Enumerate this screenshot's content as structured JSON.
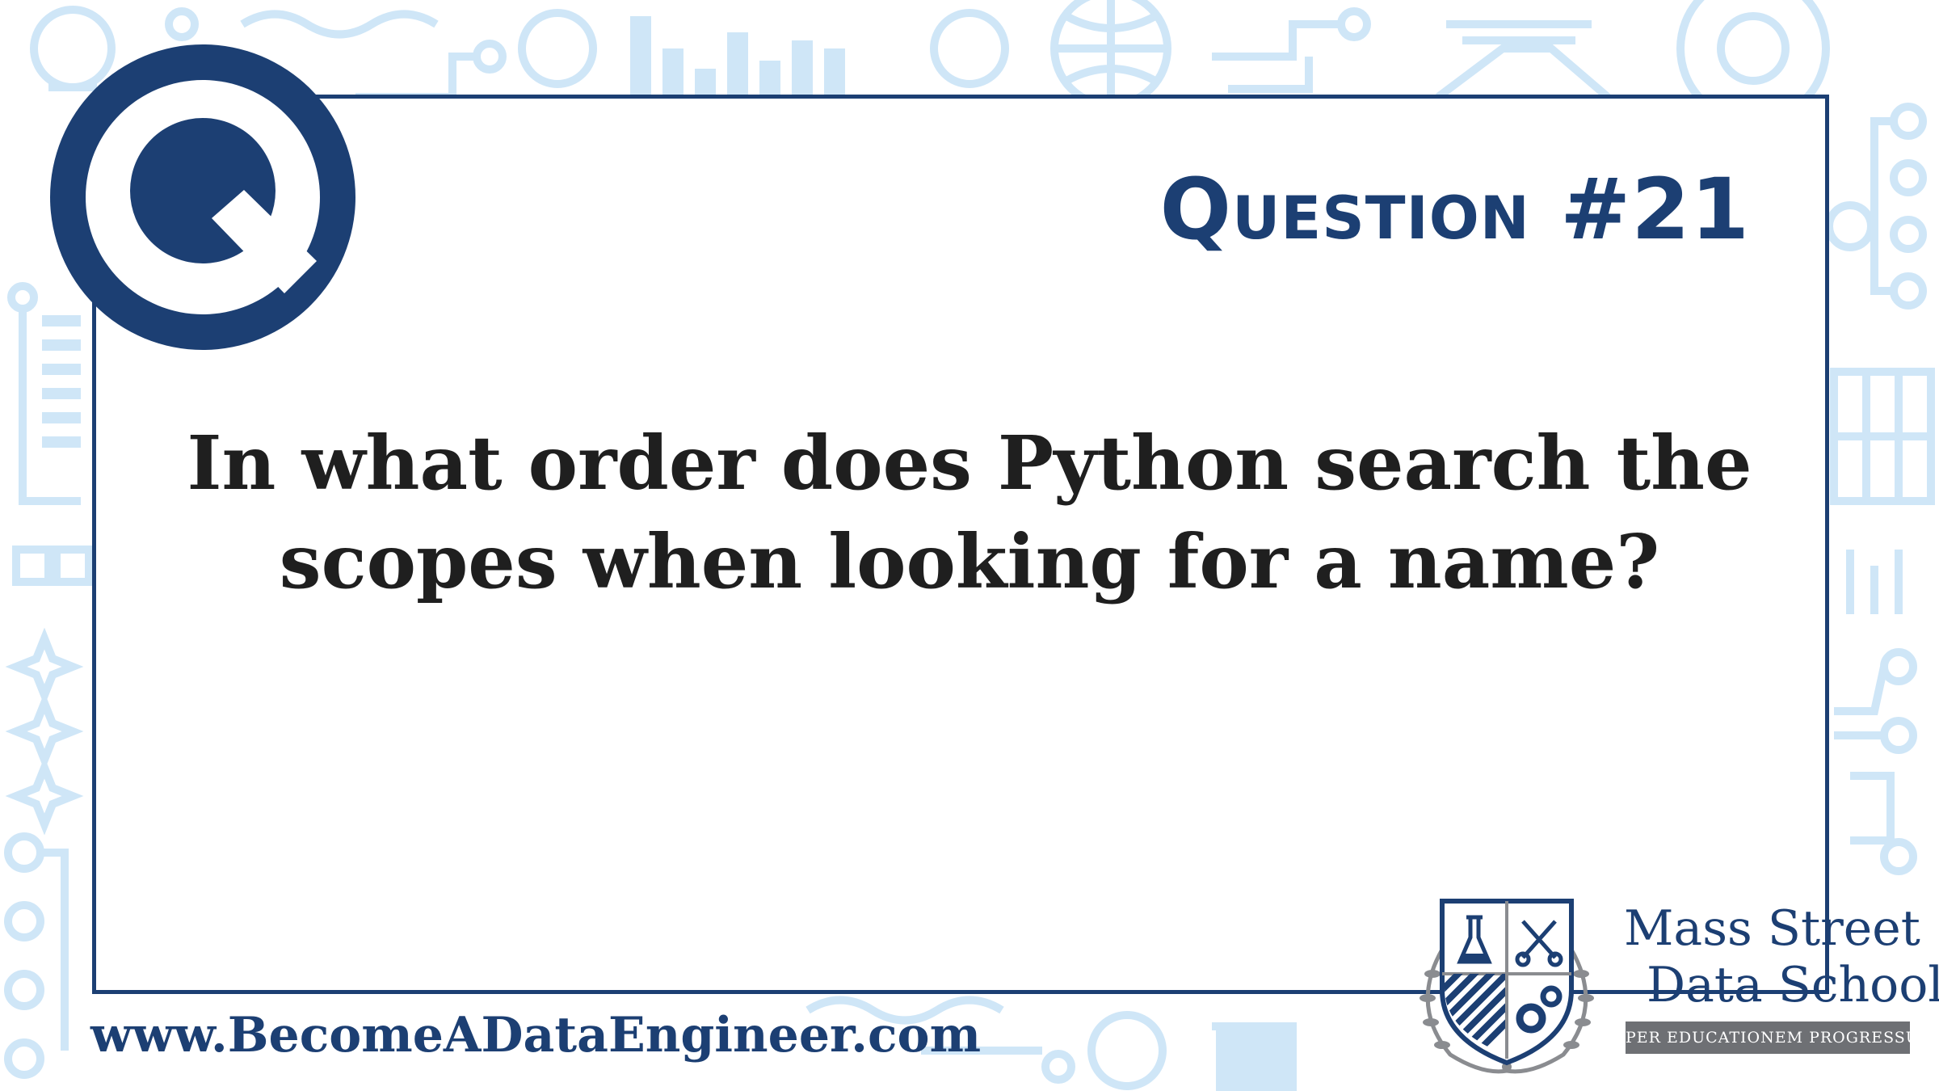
{
  "slide": {
    "question_word": "Question",
    "question_number": "#21",
    "question_text": "In what order does Python search the scopes when looking for a name?",
    "badge_letter": "Q",
    "website": "www.BecomeADataEngineer.com"
  },
  "brand": {
    "school_line1": "Mass Street",
    "school_line2": "Data School",
    "motto": "PER EDUCATIONEM PROGRESSUS"
  },
  "icons": {
    "badge": "q-badge-icon",
    "crest": "school-crest-icon",
    "background": "tech-pattern-background"
  },
  "colors": {
    "navy": "#1c3f73",
    "light_blue": "#cfe6f7",
    "text": "#1f1f1f",
    "motto_bg": "#6e7074"
  }
}
